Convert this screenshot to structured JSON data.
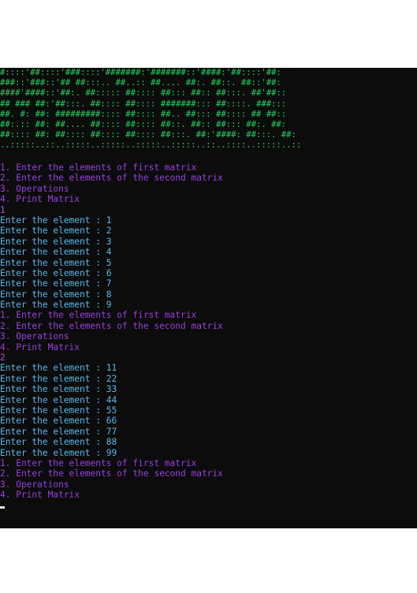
{
  "colors": {
    "background": "#0c0c0c",
    "banner_green": "#1ed760",
    "menu_purple": "#9b3fe0",
    "input_echo": "#c04ae6",
    "output_cyan": "#58b7ea"
  },
  "banner": [
    "#::::'##::::'###::::'#######:'#######::'####:'##::::'##:",
    "###::'###::'## ##:::.. ##..:: ##.... ##:. ##::. ##::'##:",
    "####'####::'##:. ##::::: ##:::: ##::: ##:: ##:::. ##'##::",
    "## ### ##:'##:::. ##:::: ##:::: #######::: ##::::. ###:::",
    "##. #: ##: #########:::: ##:::: ##.. ##::: ##:::: ## ##::",
    "##:.:: ##: ##.... ##:::: ##:::: ##::. ##:: ##::: ##:. ##:",
    "##:::: ##: ##:::: ##:::: ##:::: ##:::. ##:'####: ##:::. ##:",
    "..:::::..::..:::::..:::::..:::::..:::::..::..::::..:::::..::"
  ],
  "console": [
    {
      "text": "1. Enter the elements of first matrix",
      "kind": "menu"
    },
    {
      "text": "2. Enter the elements of the second matrix",
      "kind": "menu"
    },
    {
      "text": "3. Operations",
      "kind": "menu"
    },
    {
      "text": "4. Print Matrix",
      "kind": "menu"
    },
    {
      "text": "1",
      "kind": "input"
    },
    {
      "text": "Enter the element : 1",
      "kind": "output"
    },
    {
      "text": "Enter the element : 2",
      "kind": "output"
    },
    {
      "text": "Enter the element : 3",
      "kind": "output"
    },
    {
      "text": "Enter the element : 4",
      "kind": "output"
    },
    {
      "text": "Enter the element : 5",
      "kind": "output"
    },
    {
      "text": "Enter the element : 6",
      "kind": "output"
    },
    {
      "text": "Enter the element : 7",
      "kind": "output"
    },
    {
      "text": "Enter the element : 8",
      "kind": "output"
    },
    {
      "text": "Enter the element : 9",
      "kind": "output"
    },
    {
      "text": "1. Enter the elements of first matrix",
      "kind": "menu"
    },
    {
      "text": "2. Enter the elements of the second matrix",
      "kind": "menu"
    },
    {
      "text": "3. Operations",
      "kind": "menu"
    },
    {
      "text": "4. Print Matrix",
      "kind": "menu"
    },
    {
      "text": "2",
      "kind": "input"
    },
    {
      "text": "Enter the element : 11",
      "kind": "output"
    },
    {
      "text": "Enter the element : 22",
      "kind": "output"
    },
    {
      "text": "Enter the element : 33",
      "kind": "output"
    },
    {
      "text": "Enter the element : 44",
      "kind": "output"
    },
    {
      "text": "Enter the element : 55",
      "kind": "output"
    },
    {
      "text": "Enter the element : 66",
      "kind": "output"
    },
    {
      "text": "Enter the element : 77",
      "kind": "output"
    },
    {
      "text": "Enter the element : 88",
      "kind": "output"
    },
    {
      "text": "Enter the element : 99",
      "kind": "output"
    },
    {
      "text": "1. Enter the elements of first matrix",
      "kind": "menu"
    },
    {
      "text": "2. Enter the elements of the second matrix",
      "kind": "menu"
    },
    {
      "text": "3. Operations",
      "kind": "menu"
    },
    {
      "text": "4. Print Matrix",
      "kind": "menu"
    }
  ]
}
